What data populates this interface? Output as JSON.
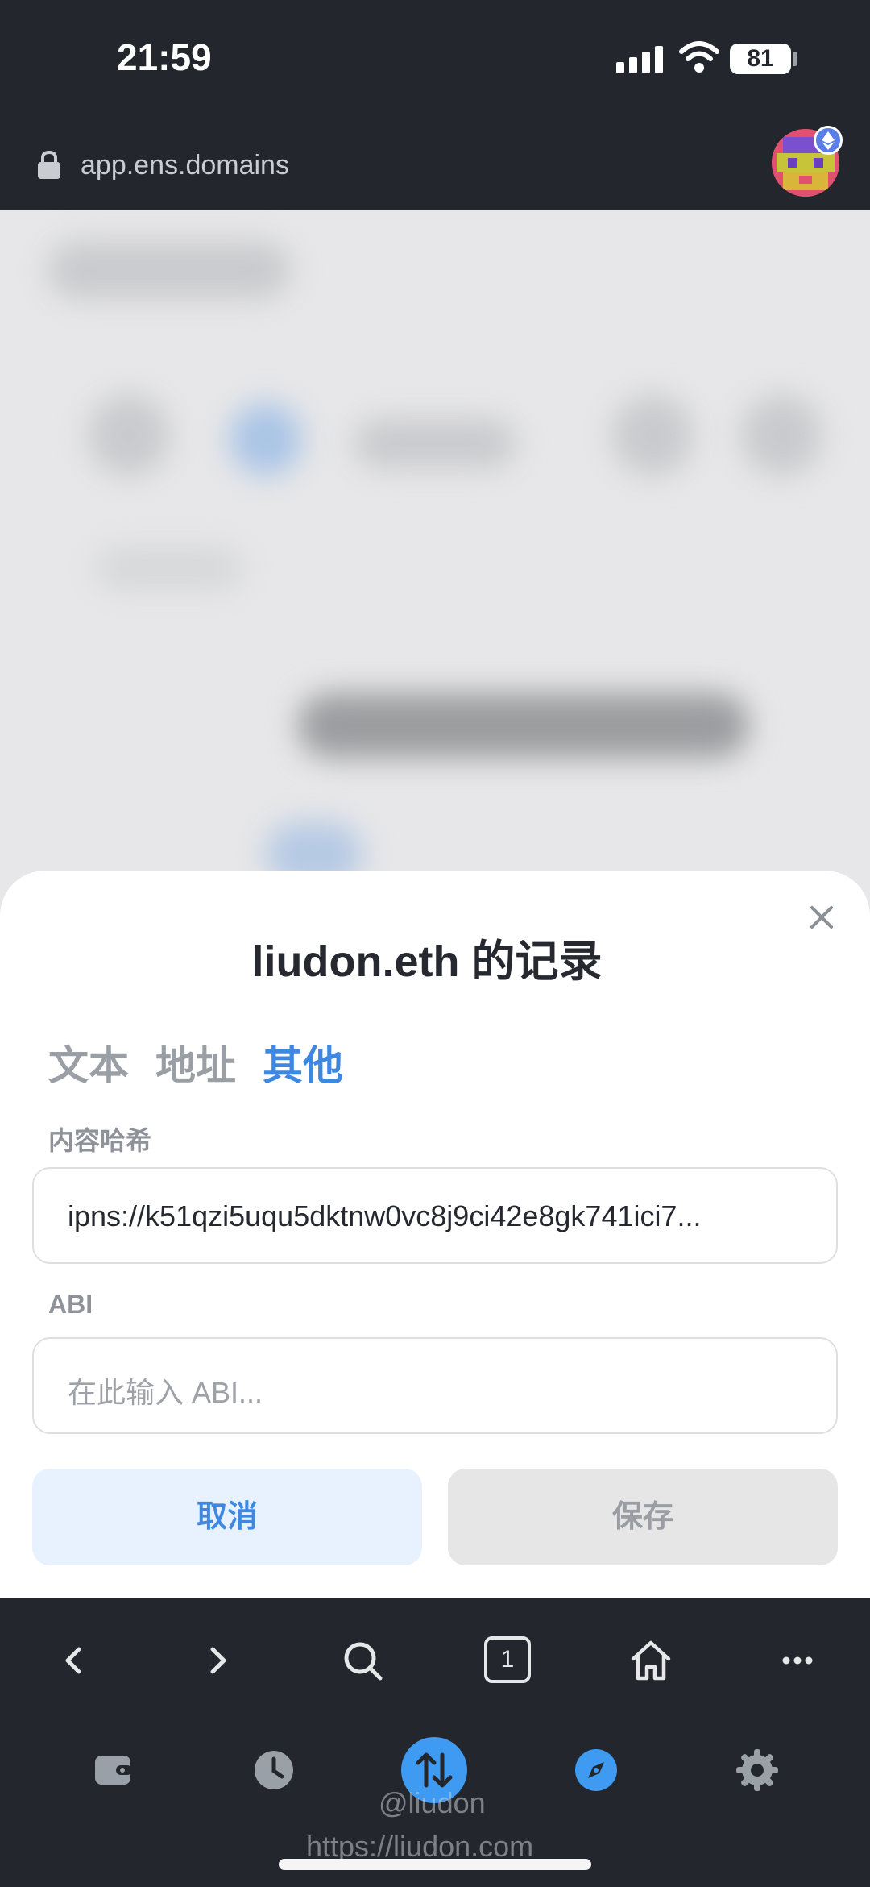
{
  "status_bar": {
    "time": "21:59",
    "battery": "81"
  },
  "browser": {
    "url": "app.ens.domains"
  },
  "modal": {
    "title": "liudon.eth 的记录",
    "tabs": [
      {
        "label": "文本",
        "active": false
      },
      {
        "label": "地址",
        "active": false
      },
      {
        "label": "其他",
        "active": true
      }
    ],
    "content_hash": {
      "label": "内容哈希",
      "value": "ipns://k51qzi5uqu5dktnw0vc8j9ci42e8gk741ici7..."
    },
    "abi": {
      "label": "ABI",
      "placeholder": "在此输入 ABI..."
    },
    "cancel_label": "取消",
    "save_label": "保存"
  },
  "toolbar": {
    "tab_count": "1"
  },
  "watermark": {
    "handle": "@liudon",
    "site": "https://liudon.com"
  },
  "colors": {
    "accent": "#3f88e2",
    "dark_bg": "#23272d",
    "fab": "#3f9af2"
  }
}
